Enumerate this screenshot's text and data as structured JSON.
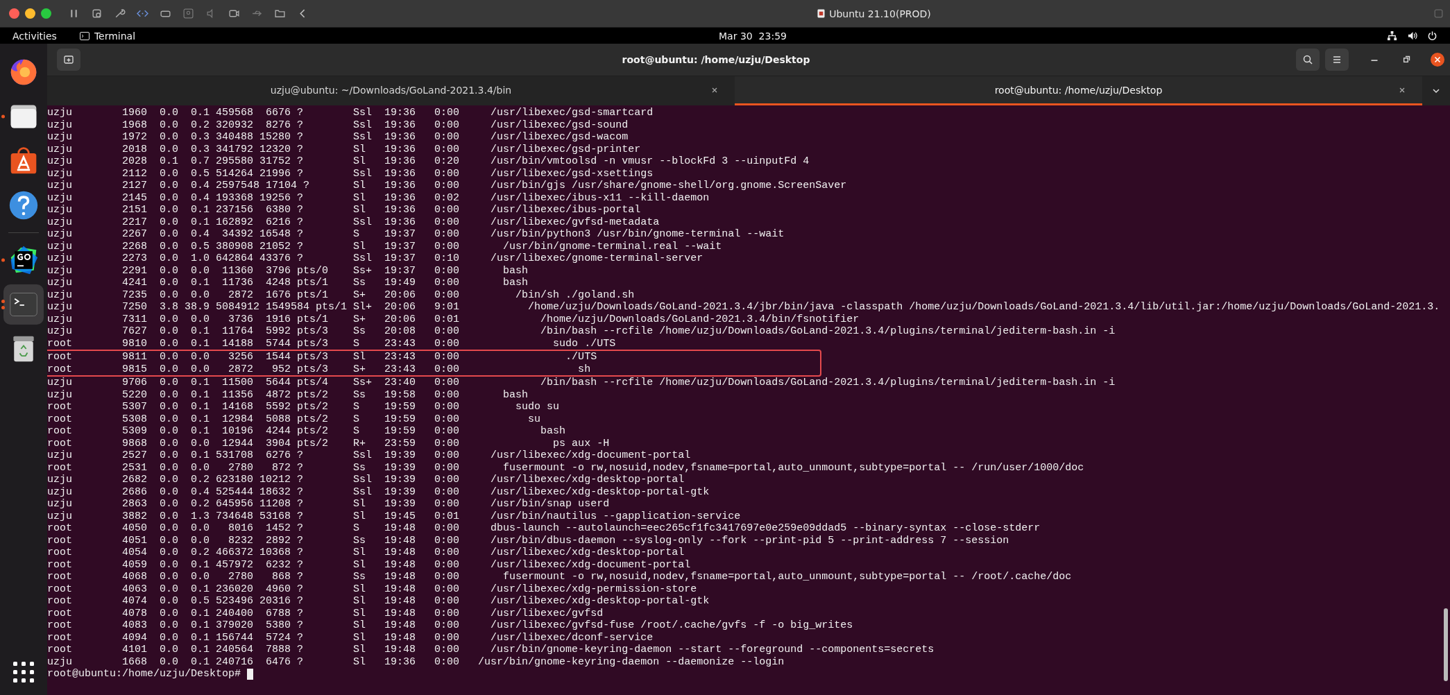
{
  "host_bar": {
    "title": "Ubuntu 21.10(PROD)"
  },
  "top_bar": {
    "activities": "Activities",
    "app": "Terminal",
    "clock": "Mar 30  23:59"
  },
  "dock": {
    "items": [
      {
        "kind": "firefox",
        "running": false,
        "multiple": false,
        "selected": false
      },
      {
        "kind": "files",
        "running": true,
        "multiple": false,
        "selected": false
      },
      {
        "kind": "software",
        "running": false,
        "multiple": false,
        "selected": false
      },
      {
        "kind": "help",
        "running": false,
        "multiple": false,
        "selected": false
      },
      {
        "kind": "goland",
        "running": true,
        "multiple": false,
        "selected": false
      },
      {
        "kind": "terminal",
        "running": true,
        "multiple": true,
        "selected": true
      },
      {
        "kind": "trash",
        "running": false,
        "multiple": false,
        "selected": false
      }
    ]
  },
  "window": {
    "title": "root@ubuntu: /home/uzju/Desktop"
  },
  "tabs": [
    {
      "label": "uzju@ubuntu: ~/Downloads/GoLand-2021.3.4/bin",
      "selected": false
    },
    {
      "label": "root@ubuntu: /home/uzju/Desktop",
      "selected": true
    }
  ],
  "terminal": {
    "lines": [
      {
        "text": "uzju        1960  0.0  0.1 459568  6676 ?        Ssl  19:36   0:00     /usr/libexec/gsd-smartcard",
        "highlighted": false
      },
      {
        "text": "uzju        1968  0.0  0.2 320932  8276 ?        Ssl  19:36   0:00     /usr/libexec/gsd-sound",
        "highlighted": false
      },
      {
        "text": "uzju        1972  0.0  0.3 340488 15280 ?        Ssl  19:36   0:00     /usr/libexec/gsd-wacom",
        "highlighted": false
      },
      {
        "text": "uzju        2018  0.0  0.3 341792 12320 ?        Sl   19:36   0:00     /usr/libexec/gsd-printer",
        "highlighted": false
      },
      {
        "text": "uzju        2028  0.1  0.7 295580 31752 ?        Sl   19:36   0:20     /usr/bin/vmtoolsd -n vmusr --blockFd 3 --uinputFd 4",
        "highlighted": false
      },
      {
        "text": "uzju        2112  0.0  0.5 514264 21996 ?        Ssl  19:36   0:00     /usr/libexec/gsd-xsettings",
        "highlighted": false
      },
      {
        "text": "uzju        2127  0.0  0.4 2597548 17104 ?       Sl   19:36   0:00     /usr/bin/gjs /usr/share/gnome-shell/org.gnome.ScreenSaver",
        "highlighted": false
      },
      {
        "text": "uzju        2145  0.0  0.4 193368 19256 ?        Sl   19:36   0:02     /usr/libexec/ibus-x11 --kill-daemon",
        "highlighted": false
      },
      {
        "text": "uzju        2151  0.0  0.1 237156  6380 ?        Sl   19:36   0:00     /usr/libexec/ibus-portal",
        "highlighted": false
      },
      {
        "text": "uzju        2217  0.0  0.1 162892  6216 ?        Ssl  19:36   0:00     /usr/libexec/gvfsd-metadata",
        "highlighted": false
      },
      {
        "text": "uzju        2267  0.0  0.4  34392 16548 ?        S    19:37   0:00     /usr/bin/python3 /usr/bin/gnome-terminal --wait",
        "highlighted": false
      },
      {
        "text": "uzju        2268  0.0  0.5 380908 21052 ?        Sl   19:37   0:00       /usr/bin/gnome-terminal.real --wait",
        "highlighted": false
      },
      {
        "text": "uzju        2273  0.0  1.0 642864 43376 ?        Ssl  19:37   0:10     /usr/libexec/gnome-terminal-server",
        "highlighted": false
      },
      {
        "text": "uzju        2291  0.0  0.0  11360  3796 pts/0    Ss+  19:37   0:00       bash",
        "highlighted": false
      },
      {
        "text": "uzju        4241  0.0  0.1  11736  4248 pts/1    Ss   19:49   0:00       bash",
        "highlighted": false
      },
      {
        "text": "uzju        7235  0.0  0.0   2872  1676 pts/1    S+   20:06   0:00         /bin/sh ./goland.sh",
        "highlighted": false
      },
      {
        "text": "uzju        7250  3.8 38.9 5084912 1549584 pts/1 Sl+  20:06   9:01           /home/uzju/Downloads/GoLand-2021.3.4/jbr/bin/java -classpath /home/uzju/Downloads/GoLand-2021.3.4/lib/util.jar:/home/uzju/Downloads/GoLand-2021.3.",
        "highlighted": false
      },
      {
        "text": "uzju        7311  0.0  0.0   3736  1916 pts/1    S+   20:06   0:01             /home/uzju/Downloads/GoLand-2021.3.4/bin/fsnotifier",
        "highlighted": false
      },
      {
        "text": "uzju        7627  0.0  0.1  11764  5992 pts/3    Ss   20:08   0:00             /bin/bash --rcfile /home/uzju/Downloads/GoLand-2021.3.4/plugins/terminal/jediterm-bash.in -i",
        "highlighted": false
      },
      {
        "text": "root        9810  0.0  0.1  14188  5744 pts/3    S    23:43   0:00               sudo ./UTS",
        "highlighted": false
      },
      {
        "text": "root        9811  0.0  0.0   3256  1544 pts/3    Sl   23:43   0:00                 ./UTS",
        "highlighted": true
      },
      {
        "text": "root        9815  0.0  0.0   2872   952 pts/3    S+   23:43   0:00                   sh",
        "highlighted": true
      },
      {
        "text": "uzju        9706  0.0  0.1  11500  5644 pts/4    Ss+  23:40   0:00             /bin/bash --rcfile /home/uzju/Downloads/GoLand-2021.3.4/plugins/terminal/jediterm-bash.in -i",
        "highlighted": false
      },
      {
        "text": "uzju        5220  0.0  0.1  11356  4872 pts/2    Ss   19:58   0:00       bash",
        "highlighted": false
      },
      {
        "text": "root        5307  0.0  0.1  14168  5592 pts/2    S    19:59   0:00         sudo su",
        "highlighted": false
      },
      {
        "text": "root        5308  0.0  0.1  12984  5088 pts/2    S    19:59   0:00           su",
        "highlighted": false
      },
      {
        "text": "root        5309  0.0  0.1  10196  4244 pts/2    S    19:59   0:00             bash",
        "highlighted": false
      },
      {
        "text": "root        9868  0.0  0.0  12944  3904 pts/2    R+   23:59   0:00               ps aux -H",
        "highlighted": false
      },
      {
        "text": "uzju        2527  0.0  0.1 531708  6276 ?        Ssl  19:39   0:00     /usr/libexec/xdg-document-portal",
        "highlighted": false
      },
      {
        "text": "root        2531  0.0  0.0   2780   872 ?        Ss   19:39   0:00       fusermount -o rw,nosuid,nodev,fsname=portal,auto_unmount,subtype=portal -- /run/user/1000/doc",
        "highlighted": false
      },
      {
        "text": "uzju        2682  0.0  0.2 623180 10212 ?        Ssl  19:39   0:00     /usr/libexec/xdg-desktop-portal",
        "highlighted": false
      },
      {
        "text": "uzju        2686  0.0  0.4 525444 18632 ?        Ssl  19:39   0:00     /usr/libexec/xdg-desktop-portal-gtk",
        "highlighted": false
      },
      {
        "text": "uzju        2863  0.0  0.2 645956 11208 ?        Sl   19:39   0:00     /usr/bin/snap userd",
        "highlighted": false
      },
      {
        "text": "uzju        3882  0.0  1.3 734648 53168 ?        Sl   19:45   0:01     /usr/bin/nautilus --gapplication-service",
        "highlighted": false
      },
      {
        "text": "root        4050  0.0  0.0   8016  1452 ?        S    19:48   0:00     dbus-launch --autolaunch=eec265cf1fc3417697e0e259e09ddad5 --binary-syntax --close-stderr",
        "highlighted": false
      },
      {
        "text": "root        4051  0.0  0.0   8232  2892 ?        Ss   19:48   0:00     /usr/bin/dbus-daemon --syslog-only --fork --print-pid 5 --print-address 7 --session",
        "highlighted": false
      },
      {
        "text": "root        4054  0.0  0.2 466372 10368 ?        Sl   19:48   0:00     /usr/libexec/xdg-desktop-portal",
        "highlighted": false
      },
      {
        "text": "root        4059  0.0  0.1 457972  6232 ?        Sl   19:48   0:00     /usr/libexec/xdg-document-portal",
        "highlighted": false
      },
      {
        "text": "root        4068  0.0  0.0   2780   868 ?        Ss   19:48   0:00       fusermount -o rw,nosuid,nodev,fsname=portal,auto_unmount,subtype=portal -- /root/.cache/doc",
        "highlighted": false
      },
      {
        "text": "root        4063  0.0  0.1 236020  4960 ?        Sl   19:48   0:00     /usr/libexec/xdg-permission-store",
        "highlighted": false
      },
      {
        "text": "root        4074  0.0  0.5 523496 20316 ?        Sl   19:48   0:00     /usr/libexec/xdg-desktop-portal-gtk",
        "highlighted": false
      },
      {
        "text": "root        4078  0.0  0.1 240400  6788 ?        Sl   19:48   0:00     /usr/libexec/gvfsd",
        "highlighted": false
      },
      {
        "text": "root        4083  0.0  0.1 379020  5380 ?        Sl   19:48   0:00     /usr/libexec/gvfsd-fuse /root/.cache/gvfs -f -o big_writes",
        "highlighted": false
      },
      {
        "text": "root        4094  0.0  0.1 156744  5724 ?        Sl   19:48   0:00     /usr/libexec/dconf-service",
        "highlighted": false
      },
      {
        "text": "root        4101  0.0  0.1 240564  7888 ?        Sl   19:48   0:00     /usr/bin/gnome-keyring-daemon --start --foreground --components=secrets",
        "highlighted": false
      },
      {
        "text": "uzju        1668  0.0  0.1 240716  6476 ?        Sl   19:36   0:00   /usr/bin/gnome-keyring-daemon --daemonize --login",
        "highlighted": false
      }
    ],
    "prompt": "root@ubuntu:/home/uzju/Desktop#"
  }
}
